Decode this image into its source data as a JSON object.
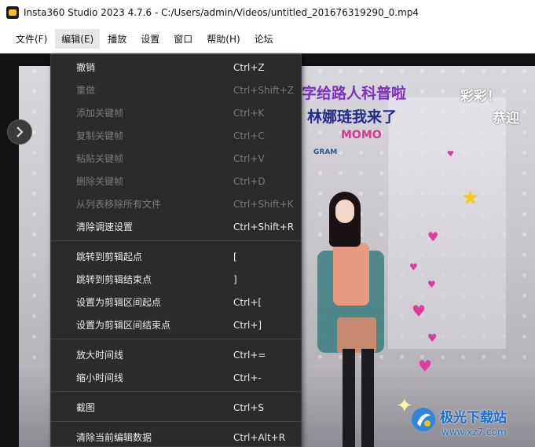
{
  "window": {
    "title": "Insta360 Studio 2023 4.7.6 - C:/Users/admin/Videos/untitled_201676319290_0.mp4"
  },
  "menubar": {
    "items": [
      {
        "label": "文件(F)"
      },
      {
        "label": "编辑(E)"
      },
      {
        "label": "播放"
      },
      {
        "label": "设置"
      },
      {
        "label": "窗口"
      },
      {
        "label": "帮助(H)"
      },
      {
        "label": "论坛"
      }
    ],
    "active_index": 1
  },
  "edit_menu": {
    "items": [
      {
        "label": "撤销",
        "shortcut": "Ctrl+Z",
        "enabled": true
      },
      {
        "label": "重做",
        "shortcut": "Ctrl+Shift+Z",
        "enabled": false
      },
      {
        "label": "添加关键帧",
        "shortcut": "Ctrl+K",
        "enabled": false
      },
      {
        "label": "复制关键帧",
        "shortcut": "Ctrl+C",
        "enabled": false
      },
      {
        "label": "粘贴关键帧",
        "shortcut": "Ctrl+V",
        "enabled": false
      },
      {
        "label": "删除关键帧",
        "shortcut": "Ctrl+D",
        "enabled": false
      },
      {
        "label": "从列表移除所有文件",
        "shortcut": "Ctrl+Shift+K",
        "enabled": false
      },
      {
        "label": "清除调速设置",
        "shortcut": "Ctrl+Shift+R",
        "enabled": true
      },
      {
        "label": "跳转到剪辑起点",
        "shortcut": "[",
        "enabled": true
      },
      {
        "label": "跳转到剪辑结束点",
        "shortcut": "]",
        "enabled": true
      },
      {
        "label": "设置为剪辑区间起点",
        "shortcut": "Ctrl+[",
        "enabled": true
      },
      {
        "label": "设置为剪辑区间结束点",
        "shortcut": "Ctrl+]",
        "enabled": true
      },
      {
        "label": "放大时间线",
        "shortcut": "Ctrl+=",
        "enabled": true
      },
      {
        "label": "缩小时间线",
        "shortcut": "Ctrl+-",
        "enabled": true
      },
      {
        "label": "截图",
        "shortcut": "Ctrl+S",
        "enabled": true
      },
      {
        "label": "清除当前编辑数据",
        "shortcut": "Ctrl+Alt+R",
        "enabled": true
      }
    ]
  },
  "video": {
    "overlays": {
      "line1": "字给路人科普啦",
      "line2": "林娜琏我来了",
      "line3": "MOMO",
      "right1": "彩彩！",
      "right2": "恭迎",
      "small": "GRAM"
    },
    "nav_icon": "chevron-right-icon"
  },
  "watermark": {
    "title": "极光下载站",
    "url": "www.xz7.com"
  },
  "colors": {
    "menu_bg": "#2b2b2b",
    "menu_text": "#ececec",
    "menu_disabled": "#7a7a7a",
    "watermark_blue": "#1b6fd1"
  }
}
